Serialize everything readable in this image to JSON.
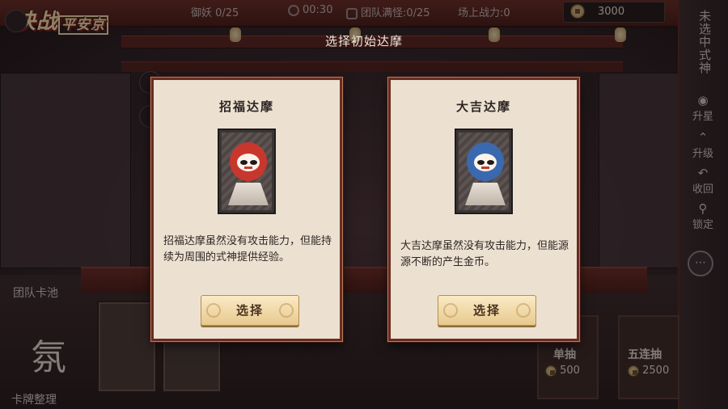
{
  "header": {
    "logo_text": "决战",
    "logo_sub": "平安京",
    "stats": [
      {
        "icon": "monster-icon",
        "text": "御妖 0/25"
      },
      {
        "icon": "clock-icon",
        "text": "00:30"
      },
      {
        "icon": "team-icon",
        "text": "团队满怪:0/25"
      },
      {
        "icon": "power-icon",
        "text": "场上战力:0"
      }
    ],
    "gold": "3000"
  },
  "sidebar": {
    "status_text": "未选中式神",
    "items": [
      {
        "label": "升星",
        "icon": "star-pin-icon"
      },
      {
        "label": "升级",
        "icon": "level-up-icon"
      },
      {
        "label": "收回",
        "icon": "recall-icon"
      },
      {
        "label": "锁定",
        "icon": "lock-icon"
      }
    ]
  },
  "left": {
    "team_pool_label": "团队卡池",
    "card_sort_label": "卡牌整理"
  },
  "shop": {
    "single": {
      "label": "单抽",
      "price": "500"
    },
    "five": {
      "label": "五连抽",
      "price": "2500"
    }
  },
  "modal": {
    "title": "选择初始达摩",
    "cards": [
      {
        "name": "招福达摩",
        "color": "#c8372d",
        "description": "招福达摩虽然没有攻击能力，但能持续为周围的式神提供经验。",
        "button": "选择"
      },
      {
        "name": "大吉达摩",
        "color": "#3b69b0",
        "description": "大吉达摩虽然没有攻击能力，但能源源不断的产生金币。",
        "button": "选择"
      }
    ]
  }
}
